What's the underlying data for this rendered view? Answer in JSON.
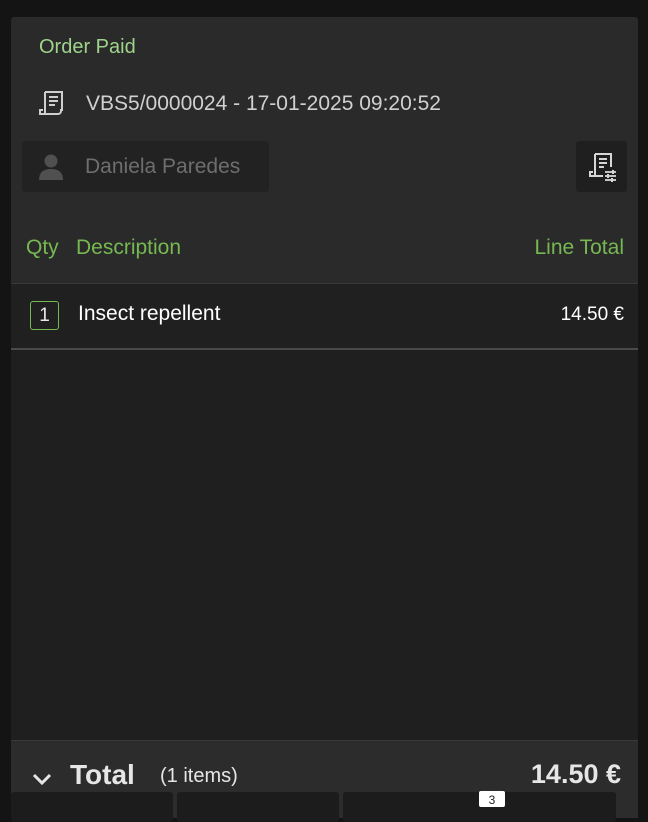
{
  "order": {
    "status": "Order Paid",
    "receipt_id": "VBS5/0000024 - 17-01-2025 09:20:52",
    "customer_name": "Daniela Paredes"
  },
  "columns": {
    "qty": "Qty",
    "description": "Description",
    "line_total": "Line Total"
  },
  "lines": [
    {
      "qty": "1",
      "description": "Insect repellent",
      "total": "14.50 €"
    }
  ],
  "totals": {
    "label": "Total",
    "count": "(1 items)",
    "amount": "14.50 €"
  },
  "footer": {
    "badge": "3"
  },
  "icons": {
    "receipt": "receipt-icon",
    "user": "user-icon",
    "receipt_options": "receipt-options-icon",
    "chevron": "chevron-down-icon"
  },
  "colors": {
    "accent": "#76b852",
    "status": "#9fd38a",
    "panel": "#2a2a2a",
    "background": "#141414"
  }
}
